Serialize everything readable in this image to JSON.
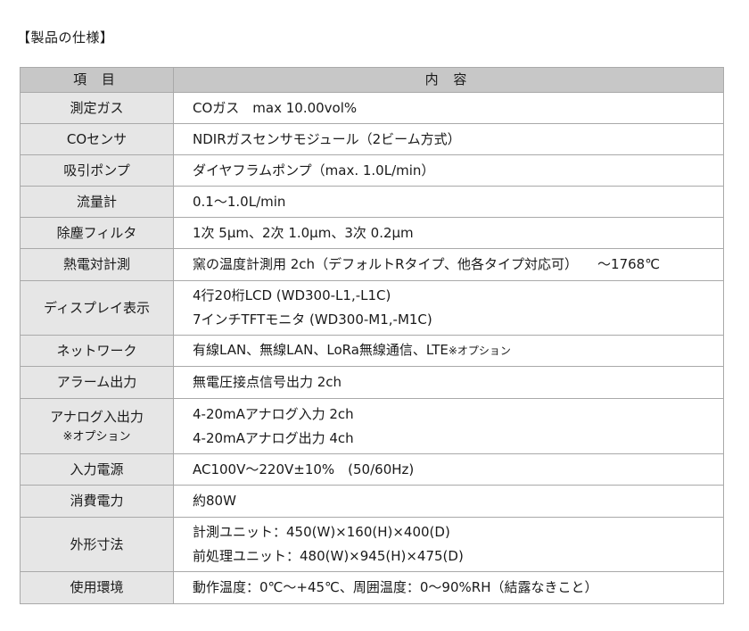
{
  "heading": "【製品の仕様】",
  "table": {
    "headers": [
      "項 目",
      "内 容"
    ],
    "rows": [
      {
        "label": "測定ガス",
        "value": [
          "COガス　max 10.00vol%"
        ]
      },
      {
        "label": "COセンサ",
        "value": [
          "NDIRガスセンサモジュール（2ビーム方式）"
        ]
      },
      {
        "label": "吸引ポンプ",
        "value": [
          "ダイヤフラムポンプ（max. 1.0L/min）"
        ]
      },
      {
        "label": "流量計",
        "value": [
          "0.1～1.0L/min"
        ]
      },
      {
        "label": "除塵フィルタ",
        "value": [
          "1次 5µm、2次 1.0µm、3次 0.2µm"
        ]
      },
      {
        "label": "熱電対計測",
        "value": [
          "窯の温度計測用 2ch（デフォルトRタイプ、他各タイプ対応可）",
          "～1768℃"
        ]
      },
      {
        "label": "ディスプレイ表示",
        "value": [
          "4行20桁LCD (WD300-L1,-L1C)",
          "7インチTFTモニタ (WD300-M1,-M1C)"
        ]
      },
      {
        "label": "ネットワーク",
        "value": [
          "有線LAN、無線LAN、LoRa無線通信、LTE",
          "※オプション"
        ]
      },
      {
        "label": "アラーム出力",
        "value": [
          "無電圧接点信号出力 2ch"
        ]
      },
      {
        "label": "アナログ入出力",
        "sublabel": "※オプション",
        "value": [
          "4-20mAアナログ入力 2ch",
          "4-20mAアナログ出力 4ch"
        ]
      },
      {
        "label": "入力電源",
        "value": [
          "AC100V～220V±10%　(50/60Hz)"
        ]
      },
      {
        "label": "消費電力",
        "value": [
          "約80W"
        ]
      },
      {
        "label": "外形寸法",
        "value": [
          "計測ユニット：450(W)×160(H)×400(D)",
          "前処理ユニット：480(W)×945(H)×475(D)"
        ]
      },
      {
        "label": "使用環境",
        "value": [
          "動作温度：0℃～+45℃、周囲温度：0～90%RH（結露なきこと）"
        ]
      }
    ]
  }
}
